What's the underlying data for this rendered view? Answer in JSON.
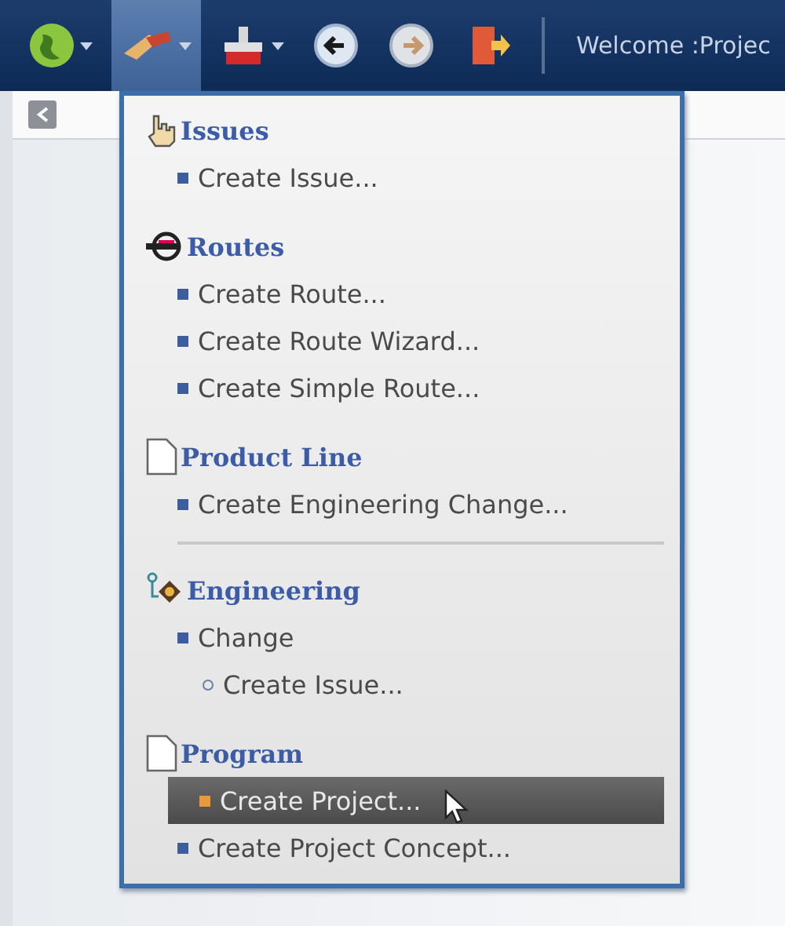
{
  "toolbar": {
    "buttons": [
      {
        "kind": "globe",
        "selected": false
      },
      {
        "kind": "tools",
        "selected": true
      },
      {
        "kind": "toolbox",
        "selected": false
      },
      {
        "kind": "back",
        "selected": false
      },
      {
        "kind": "forward",
        "selected": false
      },
      {
        "kind": "exit",
        "selected": false
      }
    ],
    "welcome": "Welcome :Projec"
  },
  "menu": {
    "sections": [
      {
        "kind": "hand",
        "title": "Issues",
        "items": [
          {
            "label": "Create Issue...",
            "selected": false
          }
        ]
      },
      {
        "kind": "route",
        "title": "Routes",
        "items": [
          {
            "label": "Create Route...",
            "selected": false
          },
          {
            "label": "Create Route Wizard...",
            "selected": false
          },
          {
            "label": "Create Simple Route...",
            "selected": false
          }
        ]
      },
      {
        "kind": "page",
        "title": "Product Line",
        "items": [
          {
            "label": "Create Engineering Change...",
            "selected": false
          }
        ]
      },
      {
        "kind": "separator"
      },
      {
        "kind": "engineering",
        "title": "Engineering",
        "items": [
          {
            "label": "Change",
            "selected": false,
            "children": [
              {
                "label": "Create Issue...",
                "selected": false
              }
            ]
          }
        ]
      },
      {
        "kind": "page",
        "title": "Program",
        "items": [
          {
            "label": "Create Project...",
            "selected": true
          },
          {
            "label": "Create Project Concept...",
            "selected": false
          }
        ]
      }
    ]
  }
}
